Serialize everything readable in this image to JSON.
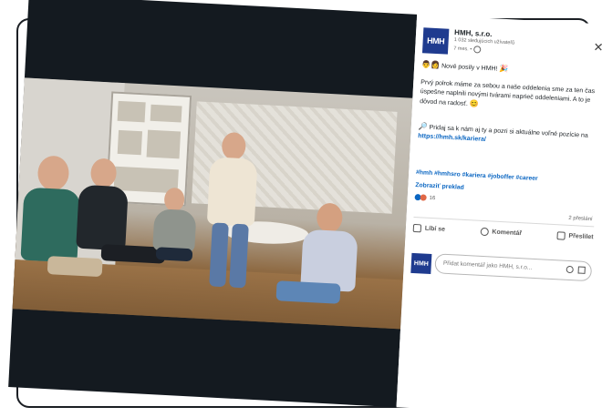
{
  "post": {
    "company": "HMH, s.r.o.",
    "logo_text": "HMH",
    "followers": "1 032 sledujúcich užívateľů",
    "time": "7 mes. •",
    "headline": "Nové posily v HMH!",
    "paragraph1": "Prvý polrok máme za sebou a naše oddelenia sme za ten čas úspešne naplnili novými tvárami naprieč oddeleniami. A to je dôvod na radosť.",
    "paragraph2_prefix": "Pridaj sa k nám aj ty a pozri si aktuálne voľné pozície na",
    "link": "https://hmh.sk/kariera/",
    "hashtags": "#hmh #hmhsro #kariera #joboffer #career",
    "translate": "Zobraziť preklad",
    "reaction_count": "16",
    "shares": "2 přeslání"
  },
  "actions": {
    "like": "Líbí se",
    "comment": "Komentář",
    "share": "Přeslilet"
  },
  "comment": {
    "placeholder": "Přidat komentář jako HMH, s.r.o..."
  },
  "icons": {
    "close": "close-icon",
    "globe": "globe-icon",
    "like": "thumbs-up-icon",
    "comment": "comment-icon",
    "share": "share-icon",
    "emoji": "emoji-icon",
    "image": "image-icon"
  },
  "colors": {
    "brand": "#1f3b8f",
    "link": "#0a66c2",
    "media_bg": "#141a20"
  }
}
